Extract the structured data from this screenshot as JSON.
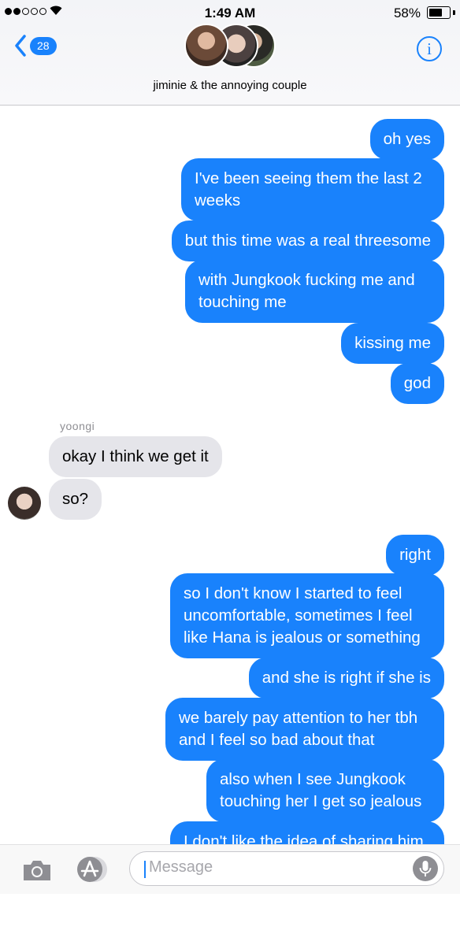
{
  "status_bar": {
    "time": "1:49 AM",
    "battery": "58%",
    "battery_level": 0.58,
    "signal_bars_filled": 2,
    "signal_bars_total": 5
  },
  "header": {
    "back_count": "28",
    "group_name": "jiminie & the annoying couple"
  },
  "messages": [
    {
      "direction": "outgoing",
      "text": "oh yes"
    },
    {
      "direction": "outgoing",
      "text": "I've been seeing them the last 2 weeks"
    },
    {
      "direction": "outgoing",
      "text": "but this time was a real threesome"
    },
    {
      "direction": "outgoing",
      "text": "with Jungkook fucking me and touching me"
    },
    {
      "direction": "outgoing",
      "text": "kissing me"
    },
    {
      "direction": "outgoing",
      "text": "god"
    },
    {
      "direction": "incoming",
      "sender": "yoongi",
      "text": "okay I think we get it"
    },
    {
      "direction": "incoming",
      "text": "so?"
    },
    {
      "direction": "outgoing",
      "text": "right"
    },
    {
      "direction": "outgoing",
      "text": "so I don't know I started to feel uncomfortable, sometimes I feel like Hana is jealous or something"
    },
    {
      "direction": "outgoing",
      "text": "and she is right if she is"
    },
    {
      "direction": "outgoing",
      "text": "we barely pay attention to her tbh and I feel so bad about that"
    },
    {
      "direction": "outgoing",
      "text": "also when I see Jungkook touching her I get so jealous"
    },
    {
      "direction": "outgoing",
      "text": "I don't like the idea of sharing him"
    }
  ],
  "composer": {
    "placeholder": "Message"
  },
  "colors": {
    "outgoing_bubble": "#1982fc",
    "incoming_bubble": "#e5e5ea",
    "accent": "#1982fc"
  },
  "icons": [
    "signal-dots-icon",
    "wifi-icon",
    "battery-icon",
    "back-chevron-icon",
    "info-icon",
    "camera-icon",
    "app-store-icon",
    "microphone-icon"
  ]
}
